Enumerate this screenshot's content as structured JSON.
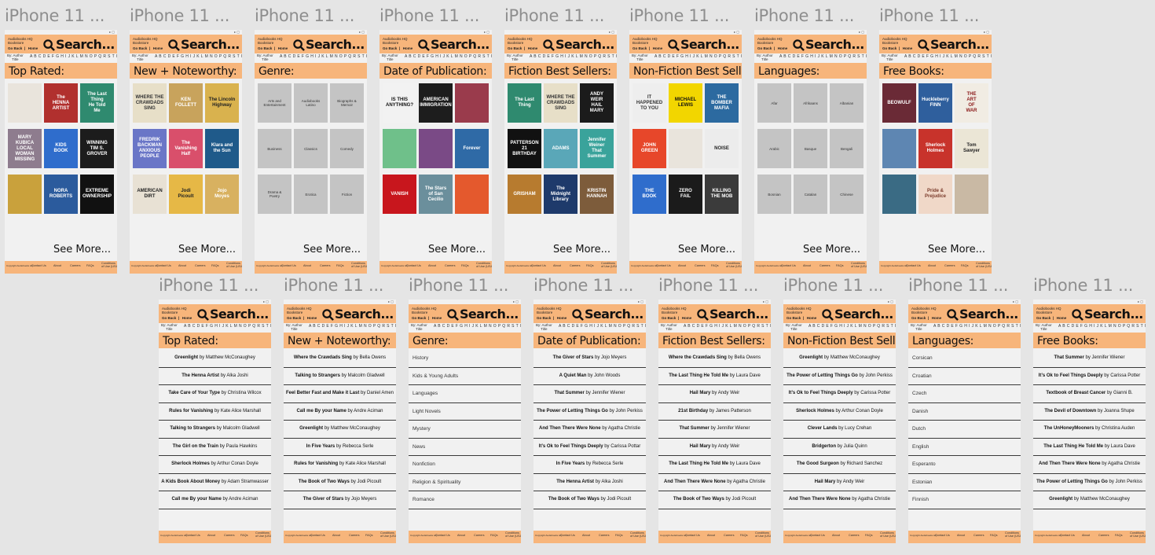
{
  "common": {
    "frame_label": "iPhone 11 ...",
    "status": "▸ ▢",
    "brand": "Audiobooks HQ\nBookstore",
    "nav": "Go Back  |   Home",
    "search": "Search...",
    "by": "By: Author\n     Title",
    "alphabet": "A B C D E F G H I J K L M N O P Q R S T U V W X Y Z",
    "see_more": "See More...",
    "copyright": "Copyright Audiobooks HQ",
    "footer_links": [
      "Contact Us",
      "About",
      "Careers",
      "FAQs",
      "Conditions\nof Use (USA)"
    ]
  },
  "colors": {
    "accent": "#f7b57b",
    "panel": "#f1f1f1",
    "background": "#e5e5e5",
    "placeholder": "#c4c4c4"
  },
  "top_frames": [
    {
      "title": "Top Rated:",
      "books": [
        {
          "label": "",
          "bg": "#e9e4dc",
          "fg": "#333"
        },
        {
          "label": "The\nHENNA\nARTIST",
          "bg": "#b1302e",
          "fg": "#fff"
        },
        {
          "label": "The Last\nThing\nHe Told\nMe",
          "bg": "#2f8a6f",
          "fg": "#fff"
        },
        {
          "label": "MARY KUBICA\nLOCAL\nWOMAN\nMISSING",
          "bg": "#8e7c8e",
          "fg": "#fff"
        },
        {
          "label": "KIDS\nBOOK",
          "bg": "#2f6dcc",
          "fg": "#fff"
        },
        {
          "label": "WINNING\nTIM S. GROVER",
          "bg": "#1c1c1c",
          "fg": "#fff"
        },
        {
          "label": "",
          "bg": "#c9a13c",
          "fg": "#222"
        },
        {
          "label": "NORA\nROBERTS",
          "bg": "#2b5b9d",
          "fg": "#fff"
        },
        {
          "label": "EXTREME\nOWNERSHIP",
          "bg": "#111",
          "fg": "#fff"
        }
      ]
    },
    {
      "title": "New + Noteworthy:",
      "books": [
        {
          "label": "WHERE THE\nCRAWDADS\nSING",
          "bg": "#e7dfc8",
          "fg": "#333"
        },
        {
          "label": "KEN\nFOLLETT",
          "bg": "#c8a35c",
          "fg": "#fff"
        },
        {
          "label": "The Lincoln\nHighway",
          "bg": "#d9b24e",
          "fg": "#222"
        },
        {
          "label": "FREDRIK\nBACKMAN\nANXIOUS\nPEOPLE",
          "bg": "#6a76c7",
          "fg": "#fff"
        },
        {
          "label": "The\nVanishing\nHalf",
          "bg": "#d94f6b",
          "fg": "#fff"
        },
        {
          "label": "Klara and\nthe Sun",
          "bg": "#1f5a8a",
          "fg": "#fff"
        },
        {
          "label": "AMERICAN\nDIRT",
          "bg": "#e8e1d4",
          "fg": "#222"
        },
        {
          "label": "Jodi\nPicoult",
          "bg": "#e6b846",
          "fg": "#222"
        },
        {
          "label": "Jojo\nMoyes",
          "bg": "#d8b160",
          "fg": "#fff"
        }
      ]
    },
    {
      "title": "Genre:",
      "books": [
        {
          "label": "Arts and\nEntertainment",
          "bg": "#c4c4c4",
          "fg": "#333",
          "gray": true
        },
        {
          "label": "Audiobooks\nLatino",
          "bg": "#c4c4c4",
          "fg": "#333",
          "gray": true
        },
        {
          "label": "Biographs &\nMemoir",
          "bg": "#c4c4c4",
          "fg": "#333",
          "gray": true
        },
        {
          "label": "Business",
          "bg": "#c4c4c4",
          "fg": "#333",
          "gray": true
        },
        {
          "label": "Classics",
          "bg": "#c4c4c4",
          "fg": "#333",
          "gray": true
        },
        {
          "label": "Comedy",
          "bg": "#c4c4c4",
          "fg": "#333",
          "gray": true
        },
        {
          "label": "Drama &\nPoetry",
          "bg": "#c4c4c4",
          "fg": "#333",
          "gray": true
        },
        {
          "label": "Erotica",
          "bg": "#c4c4c4",
          "fg": "#333",
          "gray": true
        },
        {
          "label": "Fiction",
          "bg": "#c4c4c4",
          "fg": "#333",
          "gray": true
        }
      ]
    },
    {
      "title": "Date of Publication:",
      "books": [
        {
          "label": "IS THIS\nANYTHING?",
          "bg": "#f2f2f2",
          "fg": "#111"
        },
        {
          "label": "AMERICAN\nIMMIGRATION",
          "bg": "#1d1d1d",
          "fg": "#fff"
        },
        {
          "label": "",
          "bg": "#9a3b4c",
          "fg": "#fff"
        },
        {
          "label": "",
          "bg": "#6fc08a",
          "fg": "#222"
        },
        {
          "label": "",
          "bg": "#7a4a86",
          "fg": "#fff"
        },
        {
          "label": "Forever",
          "bg": "#2f6aa6",
          "fg": "#fff"
        },
        {
          "label": "VANISH",
          "bg": "#c8161d",
          "fg": "#fff"
        },
        {
          "label": "The Stars\nof San Cecilio",
          "bg": "#6b8f9c",
          "fg": "#fff"
        },
        {
          "label": "",
          "bg": "#e4592d",
          "fg": "#fff"
        }
      ]
    },
    {
      "title": "Fiction Best Sellers:",
      "books": [
        {
          "label": "The Last\nThing",
          "bg": "#2f8a6f",
          "fg": "#fff"
        },
        {
          "label": "WHERE THE\nCRAWDADS\nSING",
          "bg": "#e7dfc8",
          "fg": "#333"
        },
        {
          "label": "ANDY\nWEIR\nHAIL\nMARY",
          "bg": "#1b1b1b",
          "fg": "#fff"
        },
        {
          "label": "PATTERSON\n21\nBIRTHDAY",
          "bg": "#111",
          "fg": "#fff"
        },
        {
          "label": "ADAMS",
          "bg": "#5aa7b8",
          "fg": "#fff"
        },
        {
          "label": "Jennifer\nWeiner\nThat\nSummer",
          "bg": "#3aa39b",
          "fg": "#fff"
        },
        {
          "label": "GRISHAM",
          "bg": "#b77b2f",
          "fg": "#fff"
        },
        {
          "label": "The\nMidnight\nLibrary",
          "bg": "#1e3a6b",
          "fg": "#fff"
        },
        {
          "label": "KRISTIN\nHANNAH",
          "bg": "#7d5c3b",
          "fg": "#fff"
        }
      ]
    },
    {
      "title": "Non-Fiction Best Sellers:",
      "books": [
        {
          "label": "IT HAPPENED\nTO YOU",
          "bg": "#eeeeee",
          "fg": "#333"
        },
        {
          "label": "MICHAEL\nLEWIS",
          "bg": "#f2d600",
          "fg": "#111"
        },
        {
          "label": "THE BOMBER\nMAFIA",
          "bg": "#2c6aa0",
          "fg": "#fff"
        },
        {
          "label": "JOHN\nGREEN",
          "bg": "#e7472a",
          "fg": "#fff"
        },
        {
          "label": "",
          "bg": "#e9e4dc",
          "fg": "#333"
        },
        {
          "label": "NOISE",
          "bg": "#ececec",
          "fg": "#222"
        },
        {
          "label": "THE\nBOOK",
          "bg": "#2f6dcc",
          "fg": "#fff"
        },
        {
          "label": "ZERO\nFAIL",
          "bg": "#1b1b1b",
          "fg": "#fff"
        },
        {
          "label": "KILLING\nTHE MOB",
          "bg": "#3b3b3b",
          "fg": "#fff"
        }
      ]
    },
    {
      "title": "Languages:",
      "books": [
        {
          "label": "Afar",
          "bg": "#c4c4c4",
          "fg": "#333",
          "gray": true
        },
        {
          "label": "Afrikaans",
          "bg": "#c4c4c4",
          "fg": "#333",
          "gray": true
        },
        {
          "label": "Albanian",
          "bg": "#c4c4c4",
          "fg": "#333",
          "gray": true
        },
        {
          "label": "Arabic",
          "bg": "#c4c4c4",
          "fg": "#333",
          "gray": true
        },
        {
          "label": "Basque",
          "bg": "#c4c4c4",
          "fg": "#333",
          "gray": true
        },
        {
          "label": "Bengali",
          "bg": "#c4c4c4",
          "fg": "#333",
          "gray": true
        },
        {
          "label": "Bosnian",
          "bg": "#c4c4c4",
          "fg": "#333",
          "gray": true
        },
        {
          "label": "Catalan",
          "bg": "#c4c4c4",
          "fg": "#333",
          "gray": true
        },
        {
          "label": "Chinese",
          "bg": "#c4c4c4",
          "fg": "#333",
          "gray": true
        }
      ]
    },
    {
      "title": "Free Books:",
      "books": [
        {
          "label": "BEOWULF",
          "bg": "#6a2a36",
          "fg": "#fff"
        },
        {
          "label": "Huckleberry\nFINN",
          "bg": "#2f5f9d",
          "fg": "#fff"
        },
        {
          "label": "THE\nART\nOF\nWAR",
          "bg": "#f1ece3",
          "fg": "#8b1a1a"
        },
        {
          "label": "",
          "bg": "#5e86b2",
          "fg": "#fff"
        },
        {
          "label": "Sherlock\nHolmes",
          "bg": "#c8332b",
          "fg": "#fff"
        },
        {
          "label": "Tom\nSawyer",
          "bg": "#ebe6d6",
          "fg": "#222"
        },
        {
          "label": "",
          "bg": "#3a6b84",
          "fg": "#fff"
        },
        {
          "label": "Pride &\nPrejudice",
          "bg": "#f0d8c8",
          "fg": "#7a3a2a"
        },
        {
          "label": "",
          "bg": "#c9b9a4",
          "fg": "#333"
        }
      ]
    }
  ],
  "bottom_frames": [
    {
      "title": "Top Rated:",
      "items": [
        {
          "t": "Greenlight",
          "a": " by Matthew McConaughey"
        },
        {
          "t": "The Henna Artist",
          "a": " by Alka Joshi"
        },
        {
          "t": "Take Care of Your Type",
          "a": " by Christina Wilcox"
        },
        {
          "t": "Rules for Vanishing",
          "a": " by Kate Alice Marshall"
        },
        {
          "t": "Talking to Strangers",
          "a": " by Malcolm Gladwell"
        },
        {
          "t": "The Girl on the Train",
          "a": " by Paula Hawkins"
        },
        {
          "t": "Sherlock Holmes",
          "a": " by Arthur Conan Doyle"
        },
        {
          "t": "A Kids Book About Money",
          "a": " by Adam Stramwasser"
        },
        {
          "t": "Call me By your Name",
          "a": " by Andre Aciman"
        }
      ]
    },
    {
      "title": "New + Noteworthy:",
      "items": [
        {
          "t": "Where the Crawdads Sing",
          "a": " by Bella Owens"
        },
        {
          "t": "Talking to Strangers",
          "a": " by Malcolm Gladwell"
        },
        {
          "t": "Feel Better Fast and Make it Last",
          "a": " by Daniel Amen"
        },
        {
          "t": "Call me By your Name",
          "a": " by Andre Aciman"
        },
        {
          "t": "Greenlight",
          "a": " by Matthew McConaughey"
        },
        {
          "t": "In Five Years",
          "a": " by Rebecca Serle"
        },
        {
          "t": "Rules for Vanishing",
          "a": " by Kate Alice Marshall"
        },
        {
          "t": "The Book of Two Ways",
          "a": " by Jodi Picoult"
        },
        {
          "t": "The Giver of Stars",
          "a": " by Jojo Meyers"
        }
      ]
    },
    {
      "title": "Genre:",
      "genre": true,
      "items": [
        {
          "t": "",
          "a": "History"
        },
        {
          "t": "",
          "a": "Kids & Young Adults"
        },
        {
          "t": "",
          "a": "Languages"
        },
        {
          "t": "",
          "a": "Light Novels"
        },
        {
          "t": "",
          "a": "Mystery"
        },
        {
          "t": "",
          "a": "News"
        },
        {
          "t": "",
          "a": "Nonfiction"
        },
        {
          "t": "",
          "a": "Religion & Spirituality"
        },
        {
          "t": "",
          "a": "Romance"
        }
      ]
    },
    {
      "title": "Date of Publication:",
      "items": [
        {
          "t": "The Giver of Stars",
          "a": " by Jojo Meyers"
        },
        {
          "t": "A Quiet Man",
          "a": " by John Woods"
        },
        {
          "t": "That Summer",
          "a": " by Jennifer Wiener"
        },
        {
          "t": "The Power of Letting Things Go",
          "a": " by John Perkiss"
        },
        {
          "t": "And Then There Were None",
          "a": " by Agatha Christie"
        },
        {
          "t": "It’s Ok to Feel Things Deeply",
          "a": " by Carissa Pottar"
        },
        {
          "t": "In Five Years",
          "a": " by Rebecca Serle"
        },
        {
          "t": "The Henna Artist",
          "a": " by Alka Joshi"
        },
        {
          "t": "The Book of Two Ways",
          "a": " by Jodi Picoult"
        }
      ]
    },
    {
      "title": "Fiction Best Sellers:",
      "items": [
        {
          "t": "Where the Crawdads Sing",
          "a": " by Bella Owens"
        },
        {
          "t": "The Last Thing He Told Me",
          "a": " by Laura Dave"
        },
        {
          "t": "Hail Mary",
          "a": " by Andy Weir"
        },
        {
          "t": "21st Birthday",
          "a": " by James Patterson"
        },
        {
          "t": "That Summer",
          "a": " by Jennifer Wiener"
        },
        {
          "t": "Hail Mary",
          "a": " by Andy Weir"
        },
        {
          "t": "The Last Thing He Told Me",
          "a": " by Laura Dave"
        },
        {
          "t": "And Then There Were None",
          "a": " by Agatha Christie"
        },
        {
          "t": "The Book of Two Ways",
          "a": " by Jodi Picoult"
        }
      ]
    },
    {
      "title": "Non-Fiction Best Sellers:",
      "items": [
        {
          "t": "Greenlight",
          "a": " by Matthew McConaughey"
        },
        {
          "t": "The Power of Letting Things Go",
          "a": " by John Perkiss"
        },
        {
          "t": "It’s Ok to Feel Things Deeply",
          "a": " by Carissa Potter"
        },
        {
          "t": "Sherlock Holmes",
          "a": " by Arthur Conan Doyle"
        },
        {
          "t": "Clever Lands",
          "a": " by Lucy Crehan"
        },
        {
          "t": "Bridgerton",
          "a": " by Julia Quinn"
        },
        {
          "t": "The Good Surgeon",
          "a": " by Richard Sanchez"
        },
        {
          "t": "Hail Mary",
          "a": " by Andy Weir"
        },
        {
          "t": "And Then There Were None",
          "a": " by Agatha Christie"
        }
      ]
    },
    {
      "title": "Languages:",
      "genre": true,
      "items": [
        {
          "t": "",
          "a": "Corsican"
        },
        {
          "t": "",
          "a": "Croatian"
        },
        {
          "t": "",
          "a": "Czech"
        },
        {
          "t": "",
          "a": "Danish"
        },
        {
          "t": "",
          "a": "Dutch"
        },
        {
          "t": "",
          "a": "English"
        },
        {
          "t": "",
          "a": "Esperanto"
        },
        {
          "t": "",
          "a": "Estonian"
        },
        {
          "t": "",
          "a": "Finnish"
        }
      ]
    },
    {
      "title": "Free Books:",
      "items": [
        {
          "t": "That Summer",
          "a": " by Jennifer Wiener"
        },
        {
          "t": "It’s Ok to Feel Things Deeply",
          "a": " by Carissa Potter"
        },
        {
          "t": "Textbook of Breast Cancer",
          "a": " by Gianni B."
        },
        {
          "t": "The Devil of Downtown",
          "a": " by Joanna Shupe"
        },
        {
          "t": "The UnHoneyMooners",
          "a": " by Christina Auden"
        },
        {
          "t": "The Last Thing He Told Me",
          "a": " by Laura Dave"
        },
        {
          "t": "And Then There Were None",
          "a": " by Agatha Christie"
        },
        {
          "t": "The Power of Letting Things Go",
          "a": " by John Perkiss"
        },
        {
          "t": "Greenlight",
          "a": " by Matthew McConaughey"
        }
      ]
    }
  ]
}
